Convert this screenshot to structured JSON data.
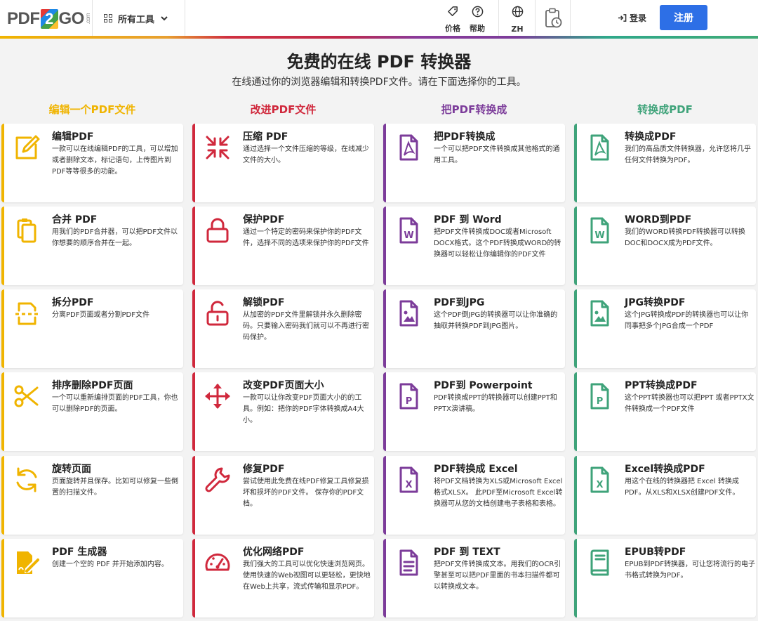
{
  "logo": {
    "pdf": "PDF",
    "two": "2",
    "go": "GO",
    "com": ".com"
  },
  "header": {
    "tools_label": "所有工具",
    "price_label": "价格",
    "help_label": "帮助",
    "lang_label": "ZH",
    "login_label": "登录",
    "register_label": "注册"
  },
  "hero": {
    "title": "免费的在线 PDF 转换器",
    "subtitle": "在线通过你的浏览器编辑和转换PDF文件。请在下面选择你的工具。"
  },
  "colors": {
    "yellow": "#f0b400",
    "red": "#d0283c",
    "purple": "#7c3c9a",
    "green": "#3fa37a"
  },
  "columns": [
    {
      "heading": "编辑一个PDF文件",
      "cards": [
        {
          "icon": "edit-icon",
          "title": "编辑PDF",
          "desc": "一款可以在线编辑PDF的工具，可以增加或者删除文本，标记语句，上传图片到PDF等等很多的功能。"
        },
        {
          "icon": "merge-icon",
          "title": "合并 PDF",
          "desc": "用我们的PDF合并器，可以把PDF文件以你想要的顺序合并在一起。"
        },
        {
          "icon": "split-icon",
          "title": "拆分PDF",
          "desc": "分离PDF页面或者分割PDF文件"
        },
        {
          "icon": "scissors-icon",
          "title": "排序删除PDF页面",
          "desc": "一个可以重新编排页面的PDF工具，你也可以删除PDF的页面。"
        },
        {
          "icon": "rotate-icon",
          "title": "旋转页面",
          "desc": "页面旋转并且保存。比如可以修复一些倒置的扫描文件。"
        },
        {
          "icon": "pdf-creator-icon",
          "title": "PDF 生成器",
          "desc": "创建一个空的 PDF 并开始添加内容。"
        }
      ]
    },
    {
      "heading": "改进PDF文件",
      "cards": [
        {
          "icon": "compress-icon",
          "title": "压缩 PDF",
          "desc": "通过选择一个文件压缩的等级，在线减少文件的大小。"
        },
        {
          "icon": "lock-icon",
          "title": "保护PDF",
          "desc": "通过一个特定的密码来保护你的PDF文件，选择不同的选项来保护你的PDF文件"
        },
        {
          "icon": "unlock-icon",
          "title": "解锁PDF",
          "desc": "从加密的PDF文件里解锁并永久删除密码。只要输入密码我们就可以不再进行密码保护。"
        },
        {
          "icon": "resize-icon",
          "title": "改变PDF页面大小",
          "desc": "一款可以让你改变PDF页面大小的的工具。例如：把你的PDF字体转换成A4大小。"
        },
        {
          "icon": "wrench-icon",
          "title": "修复PDF",
          "desc": "尝试使用此免费在线PDF修复工具修复损坏和损坏的PDF文件。 保存你的PDF文档。"
        },
        {
          "icon": "gauge-icon",
          "title": "优化网络PDF",
          "desc": "我们强大的工具可以优化快速浏览网页。 使用快速的Web视图可以更轻松，更快地在Web上共享，流式传输和显示PDF。"
        }
      ]
    },
    {
      "heading": "把PDF转换成",
      "cards": [
        {
          "icon": "pdf-file-icon",
          "title": "把PDF转换成",
          "desc": "一个可以把PDF文件转换成其他格式的通用工具。"
        },
        {
          "icon": "word-file-icon",
          "title": "PDF 到 Word",
          "desc": "把PDF文件转换成DOC或者Microsoft DOCX格式。这个PDF转换成WORD的转换器可以轻松让你编辑你的PDF文件"
        },
        {
          "icon": "image-file-icon",
          "title": "PDF到JPG",
          "desc": "这个PDF倒JPG的转换器可以让你准确的抽取并转换PDF到JPG图片。"
        },
        {
          "icon": "ppt-file-icon",
          "title": "PDF到 Powerpoint",
          "desc": "PDF转换成PPT的转换器可以创建PPT和PPTX演讲稿。"
        },
        {
          "icon": "excel-file-icon",
          "title": "PDF转换成 Excel",
          "desc": "将PDF文档转换为XLS或Microsoft Excel格式XLSX。 此PDF至Microsoft Excel转换器可从您的文档创建电子表格和表格。"
        },
        {
          "icon": "text-file-icon",
          "title": "PDF 到 TEXT",
          "desc": "把PDF文件转换成文本。用我们的OCR引擎甚至可以把PDF里面的书本扫描件都可以转换成文本。"
        }
      ]
    },
    {
      "heading": "转换成PDF",
      "cards": [
        {
          "icon": "pdf-file-icon",
          "title": "转换成PDF",
          "desc": "我们的高品质文件转换器，允许您将几乎任何文件转换为PDF。"
        },
        {
          "icon": "word-file-icon",
          "title": "WORD到PDF",
          "desc": "我们的WORD转换PDF转换器可以转换DOC和DOCX成为PDF文件。"
        },
        {
          "icon": "image-file-icon",
          "title": "JPG转换PDF",
          "desc": "这个JPG转换成PDF的转换器也可以让你同事把多个JPG合成一个PDF"
        },
        {
          "icon": "ppt-file-icon",
          "title": "PPT转换成PDF",
          "desc": "这个PPT转换器也可以把PPT 或者PPTX文件转换成一个PDF文件"
        },
        {
          "icon": "excel-file-icon",
          "title": "Excel转换成PDF",
          "desc": "用这个在线的转换器把 Excel 转换成PDF。从XLS和XLSX创建PDF文件。"
        },
        {
          "icon": "book-icon",
          "title": "EPUB转PDF",
          "desc": "EPUB到PDF转换器，可让您将流行的电子书格式转换为PDF。"
        }
      ]
    }
  ]
}
